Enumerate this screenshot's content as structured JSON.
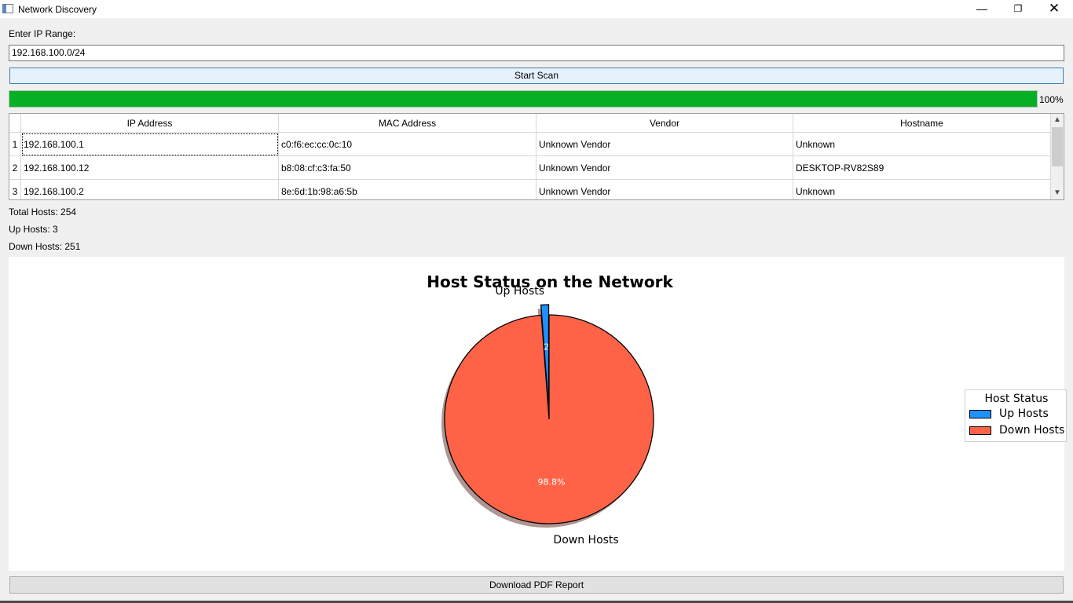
{
  "window": {
    "title": "Network Discovery"
  },
  "form": {
    "range_label": "Enter IP Range:",
    "range_value": "192.168.100.0/24",
    "scan_button": "Start Scan"
  },
  "progress": {
    "fraction": 1.0,
    "text": "100%"
  },
  "table": {
    "columns": [
      "IP Address",
      "MAC Address",
      "Vendor",
      "Hostname"
    ],
    "rows": [
      {
        "num": "1",
        "ip": "192.168.100.1",
        "mac": "c0:f6:ec:cc:0c:10",
        "vendor": "Unknown Vendor",
        "hostname": "Unknown"
      },
      {
        "num": "2",
        "ip": "192.168.100.12",
        "mac": "b8:08:cf:c3:fa:50",
        "vendor": "Unknown Vendor",
        "hostname": "DESKTOP-RV82S89"
      },
      {
        "num": "3",
        "ip": "192.168.100.2",
        "mac": "8e:6d:1b:98:a6:5b",
        "vendor": "Unknown Vendor",
        "hostname": "Unknown"
      }
    ]
  },
  "stats": {
    "total": "Total Hosts: 254",
    "up": "Up Hosts: 3",
    "down": "Down Hosts: 251"
  },
  "chart_data": {
    "type": "pie",
    "title": "Host Status on the Network",
    "categories": [
      "Up Hosts",
      "Down Hosts"
    ],
    "values": [
      3,
      251
    ],
    "percent_labels": [
      "1.2%",
      "98.8%"
    ],
    "colors": [
      "#1e90ff",
      "#ff6347"
    ],
    "exploded": [
      "Up Hosts"
    ],
    "shadow": true,
    "legend": {
      "title": "Host Status",
      "placement": "right"
    }
  },
  "actions": {
    "pdf_button": "Download PDF Report"
  }
}
